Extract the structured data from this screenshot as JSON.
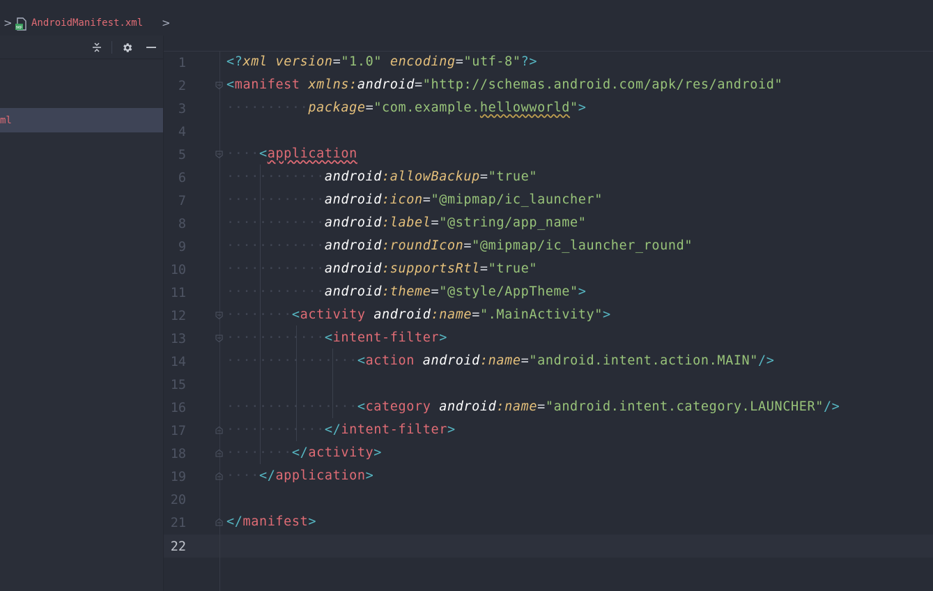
{
  "breadcrumb": {
    "file_name": "AndroidManifest.xml"
  },
  "project_panel": {
    "selected_item": "ml",
    "tools": [
      "collapse-icon",
      "gear-icon",
      "minimize-icon"
    ]
  },
  "editor": {
    "current_line": "22",
    "lines": [
      {
        "n": "1"
      },
      {
        "n": "2"
      },
      {
        "n": "3"
      },
      {
        "n": "4"
      },
      {
        "n": "5"
      },
      {
        "n": "6"
      },
      {
        "n": "7"
      },
      {
        "n": "8"
      },
      {
        "n": "9"
      },
      {
        "n": "10"
      },
      {
        "n": "11"
      },
      {
        "n": "12"
      },
      {
        "n": "13"
      },
      {
        "n": "14"
      },
      {
        "n": "15"
      },
      {
        "n": "16"
      },
      {
        "n": "17"
      },
      {
        "n": "18"
      },
      {
        "n": "19"
      },
      {
        "n": "20"
      },
      {
        "n": "21"
      },
      {
        "n": "22"
      }
    ],
    "tokens": {
      "l1": [
        "<?",
        "xml",
        " ",
        "version",
        "=",
        "\"1.0\"",
        " ",
        "encoding",
        "=",
        "\"utf-8\"",
        "?>"
      ],
      "l2": [
        "<",
        "manifest",
        " ",
        "xmlns:",
        "android",
        "=",
        "\"http://schemas.android.com/apk/res/android\""
      ],
      "l3": [
        "··········",
        "package",
        "=",
        "\"com.example.",
        "hellowworld",
        "\"",
        ">"
      ],
      "l5": [
        "····",
        "<",
        "application"
      ],
      "l6": [
        "············",
        "android",
        ":allowBackup",
        "=",
        "\"true\""
      ],
      "l7": [
        "············",
        "android",
        ":icon",
        "=",
        "\"@mipmap/ic_launcher\""
      ],
      "l8": [
        "············",
        "android",
        ":label",
        "=",
        "\"@string/app_name\""
      ],
      "l9": [
        "············",
        "android",
        ":roundIcon",
        "=",
        "\"@mipmap/ic_launcher_round\""
      ],
      "l10": [
        "············",
        "android",
        ":supportsRtl",
        "=",
        "\"true\""
      ],
      "l11": [
        "············",
        "android",
        ":theme",
        "=",
        "\"@style/AppTheme\"",
        ">"
      ],
      "l12": [
        "········",
        "<",
        "activity",
        " ",
        "android",
        ":name",
        "=",
        "\".MainActivity\"",
        ">"
      ],
      "l13": [
        "············",
        "<",
        "intent-filter",
        ">"
      ],
      "l14": [
        "················",
        "<",
        "action",
        " ",
        "android",
        ":name",
        "=",
        "\"android.intent.action.MAIN\"",
        "/>"
      ],
      "l16": [
        "················",
        "<",
        "category",
        " ",
        "android",
        ":name",
        "=",
        "\"android.intent.category.LAUNCHER\"",
        "/>"
      ],
      "l17": [
        "············",
        "</",
        "intent-filter",
        ">"
      ],
      "l18": [
        "········",
        "</",
        "activity",
        ">"
      ],
      "l19": [
        "····",
        "</",
        "application",
        ">"
      ],
      "l21": [
        "</",
        "manifest",
        ">"
      ]
    }
  }
}
